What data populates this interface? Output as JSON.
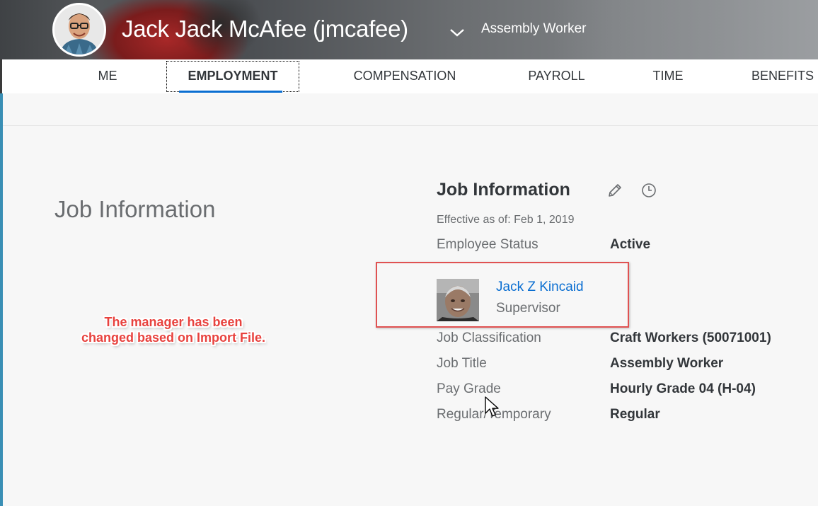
{
  "header": {
    "user_name": "Jack Jack McAfee (jmcafee)",
    "user_role": "Assembly Worker"
  },
  "tabs": [
    {
      "label": "ME"
    },
    {
      "label": "EMPLOYMENT",
      "active": true
    },
    {
      "label": "COMPENSATION"
    },
    {
      "label": "PAYROLL"
    },
    {
      "label": "TIME"
    },
    {
      "label": "BENEFITS"
    }
  ],
  "section": {
    "title": "Job Information"
  },
  "annotation": {
    "line1": "The manager has been",
    "line2": "changed based on Import File."
  },
  "job_info": {
    "title": "Job Information",
    "effective": "Effective as of: Feb 1, 2019",
    "fields": [
      {
        "label": "Employee Status",
        "value": "Active"
      },
      {
        "label": "Job Classification",
        "value": "Craft Workers (50071001)"
      },
      {
        "label": "Job Title",
        "value": "Assembly Worker"
      },
      {
        "label": "Pay Grade",
        "value": "Hourly Grade 04 (H-04)"
      },
      {
        "label": "Regular/Temporary",
        "value": "Regular"
      }
    ],
    "manager": {
      "name": "Jack Z Kincaid",
      "role": "Supervisor"
    }
  },
  "colors": {
    "accent": "#0a6ed1",
    "highlight": "#e05252",
    "annotation_text": "#e8423e"
  },
  "icons": {
    "edit": "pencil-icon",
    "history": "clock-icon",
    "expand": "chevron-down-icon"
  }
}
